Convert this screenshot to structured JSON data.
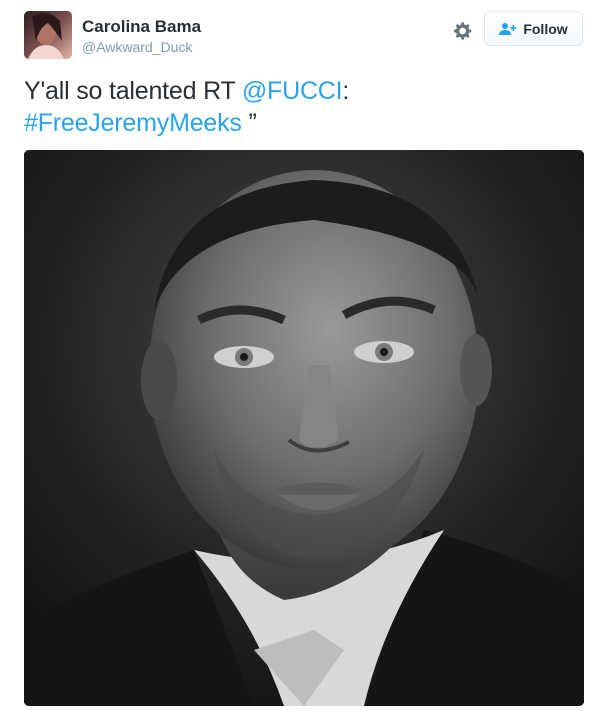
{
  "user": {
    "display_name": "Carolina Bama",
    "handle": "@Awkward_Duck"
  },
  "follow_button": {
    "label": "Follow"
  },
  "tweet": {
    "text_lead": "Y'all so talented RT ",
    "mention": "@FUCCI",
    "text_mid": ":",
    "hashtag": "#FreeJeremyMeeks",
    "text_tail": " ”"
  },
  "icons": {
    "settings": "gear-icon",
    "follow": "add-user-icon"
  },
  "colors": {
    "link": "#2aa3ef",
    "text": "#292f33",
    "muted": "#8899a6",
    "button_border": "#e1e8ed"
  }
}
